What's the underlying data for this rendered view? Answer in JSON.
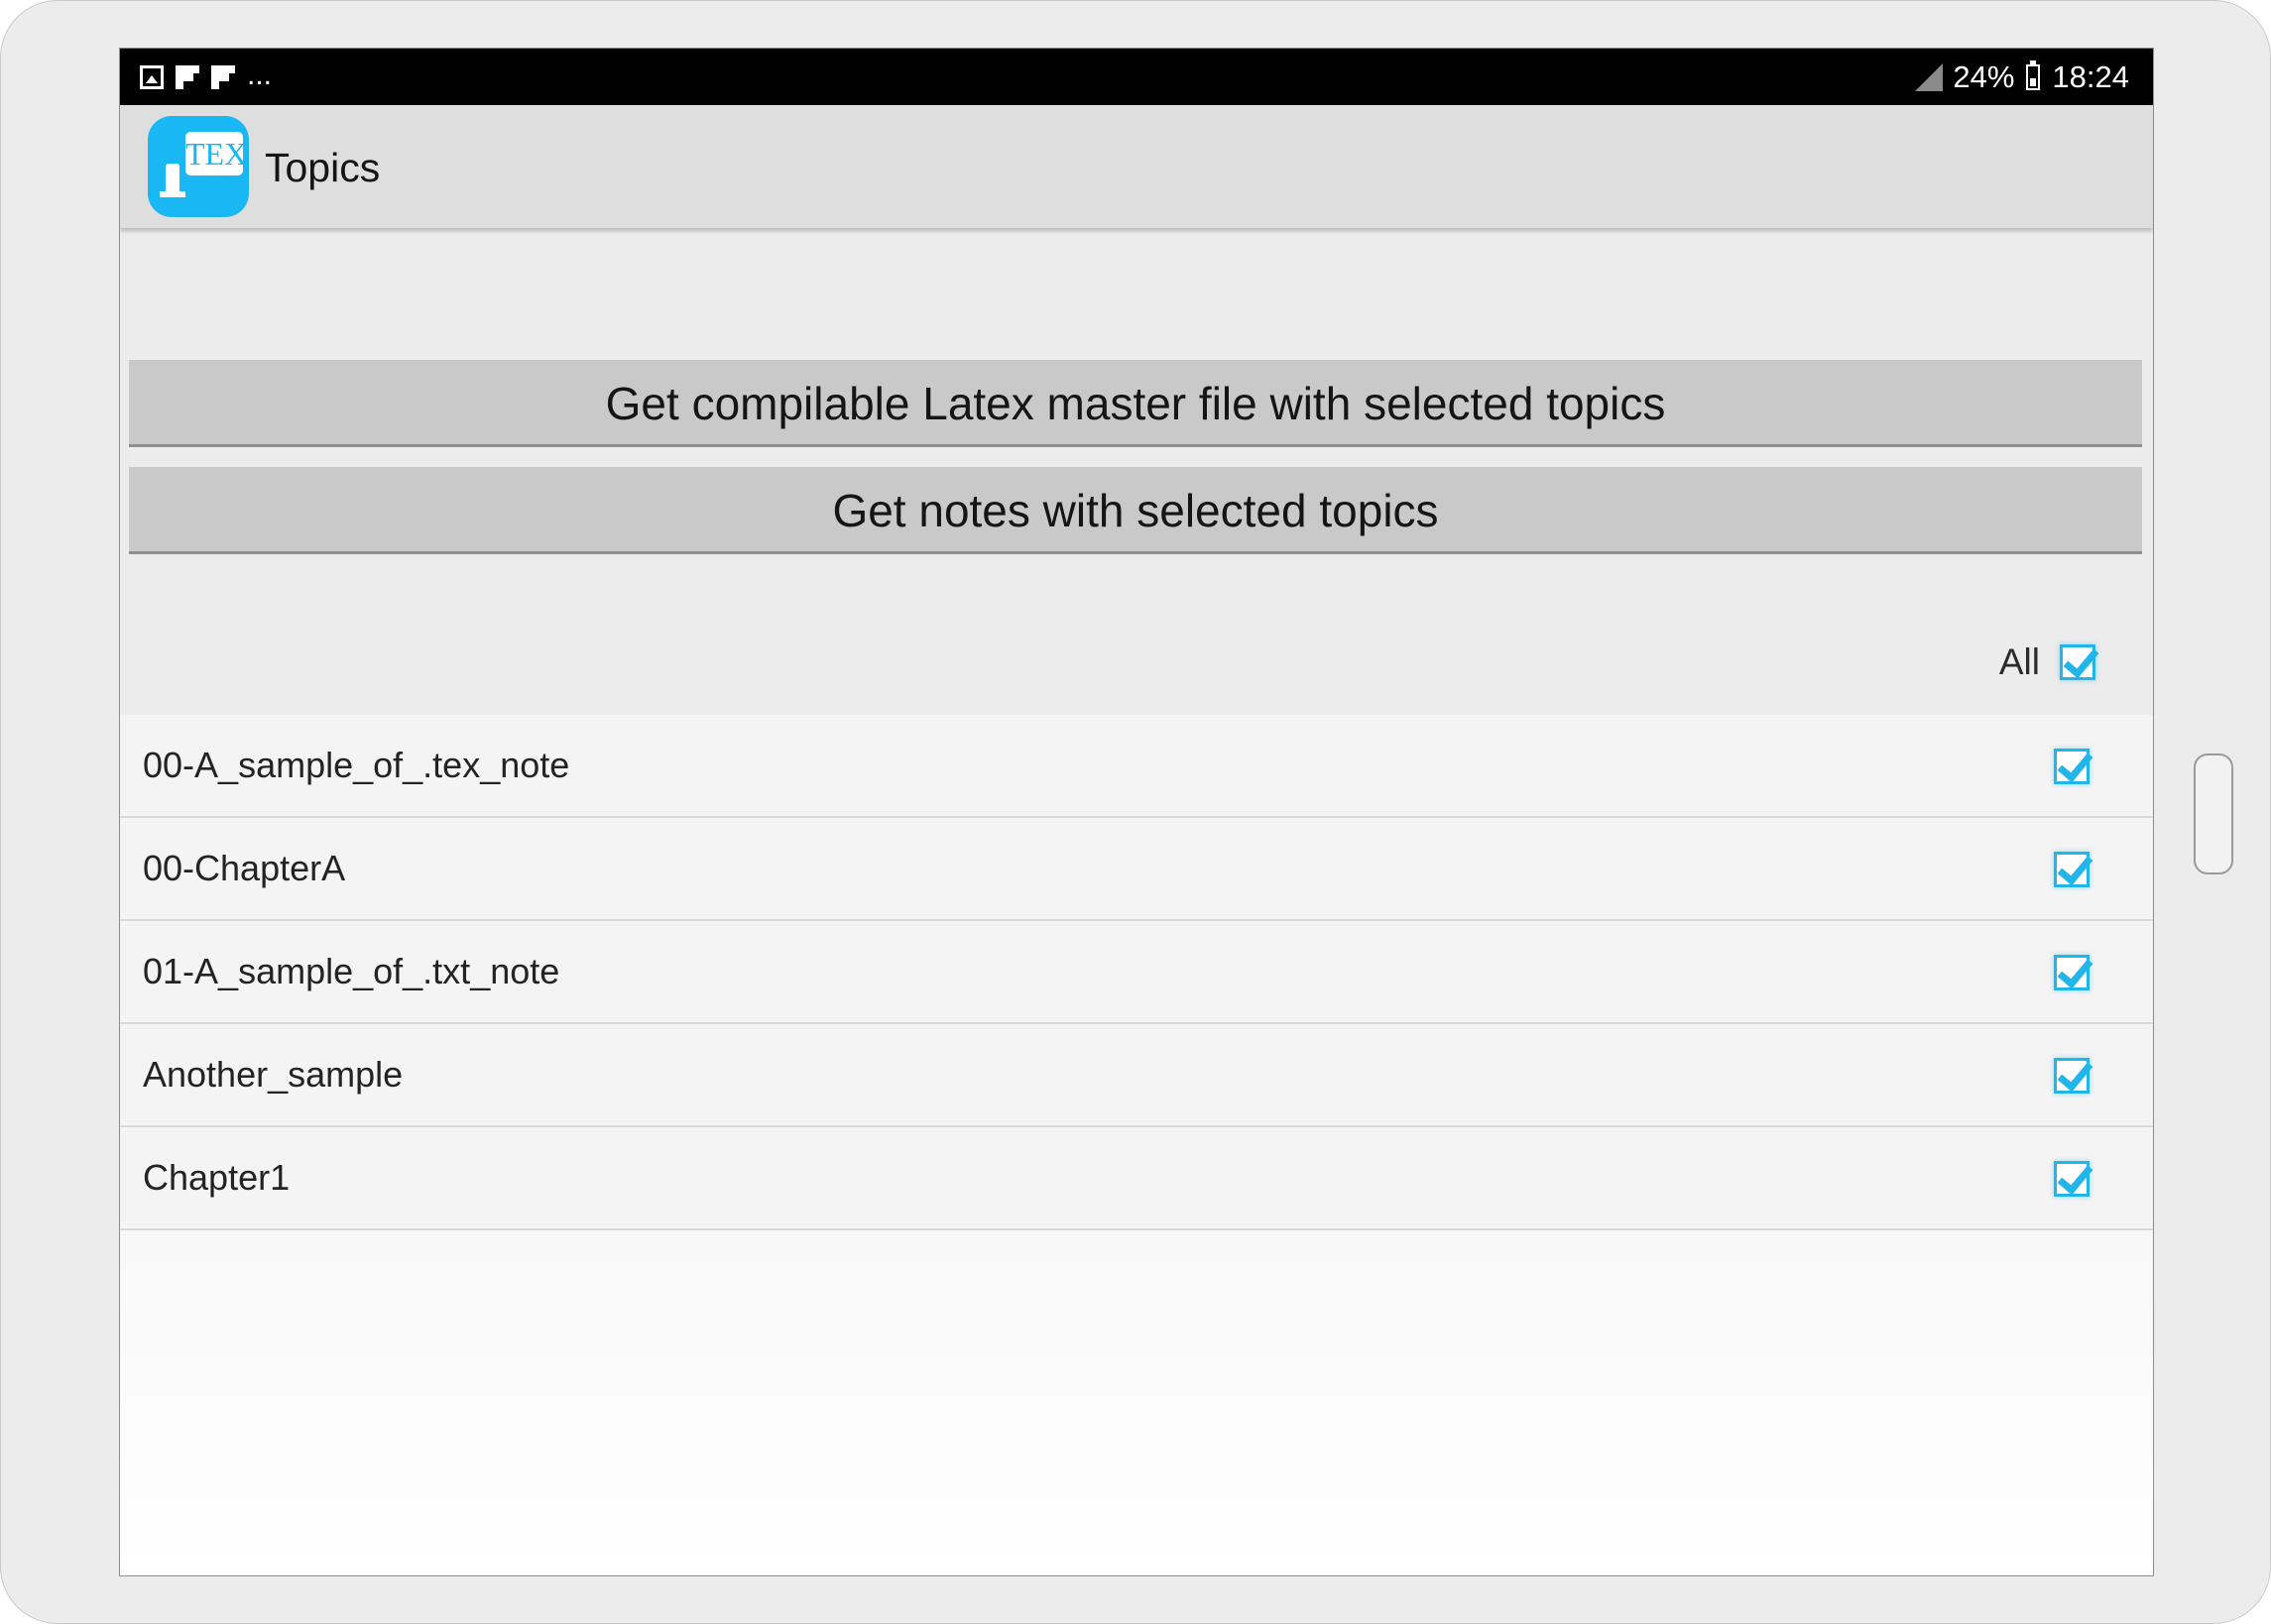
{
  "statusbar": {
    "left_icons": [
      "image-icon",
      "flipboard-icon",
      "flipboard-icon"
    ],
    "more": "...",
    "battery_percent": "24%",
    "time": "18:24"
  },
  "appbar": {
    "icon_text": "TEX",
    "title": "Topics"
  },
  "actions": {
    "latex_button": "Get compilable Latex master file with selected topics",
    "notes_button": "Get notes with selected topics"
  },
  "select_all": {
    "label": "All",
    "checked": true
  },
  "topics": [
    {
      "label": "00-A_sample_of_.tex_note",
      "checked": true
    },
    {
      "label": "00-ChapterA",
      "checked": true
    },
    {
      "label": "01-A_sample_of_.txt_note",
      "checked": true
    },
    {
      "label": "Another_sample",
      "checked": true
    },
    {
      "label": "Chapter1",
      "checked": true
    }
  ],
  "colors": {
    "accent": "#21b5ec",
    "app_icon_bg": "#19b7f3",
    "button_bg": "#c9c9c9"
  }
}
